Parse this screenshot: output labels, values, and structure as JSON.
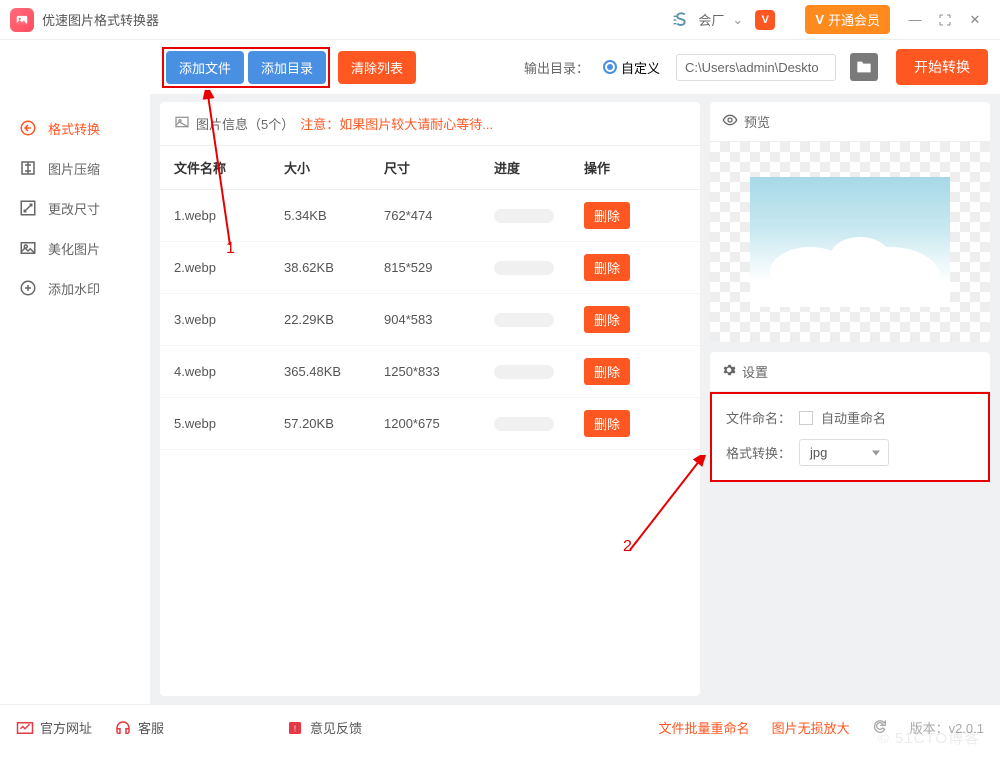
{
  "app": {
    "title": "优速图片格式转换器"
  },
  "titlebar": {
    "user": "会厂",
    "open_vip": "开通会员"
  },
  "toolbar": {
    "add_file": "添加文件",
    "add_folder": "添加目录",
    "clear_list": "清除列表",
    "output_label": "输出目录：",
    "custom_label": "自定义",
    "path": "C:\\Users\\admin\\Deskto",
    "start": "开始转换"
  },
  "sidebar": {
    "items": [
      {
        "label": "格式转换"
      },
      {
        "label": "图片压缩"
      },
      {
        "label": "更改尺寸"
      },
      {
        "label": "美化图片"
      },
      {
        "label": "添加水印"
      }
    ]
  },
  "info": {
    "label": "图片信息（5个）",
    "warn": "注意：如果图片较大请耐心等待..."
  },
  "table": {
    "headers": {
      "name": "文件名称",
      "size": "大小",
      "dim": "尺寸",
      "prog": "进度",
      "act": "操作"
    },
    "delete_label": "删除",
    "rows": [
      {
        "name": "1.webp",
        "size": "5.34KB",
        "dim": "762*474"
      },
      {
        "name": "2.webp",
        "size": "38.62KB",
        "dim": "815*529"
      },
      {
        "name": "3.webp",
        "size": "22.29KB",
        "dim": "904*583"
      },
      {
        "name": "4.webp",
        "size": "365.48KB",
        "dim": "1250*833"
      },
      {
        "name": "5.webp",
        "size": "57.20KB",
        "dim": "1200*675"
      }
    ]
  },
  "preview": {
    "title": "预览"
  },
  "settings": {
    "title": "设置",
    "file_naming_label": "文件命名：",
    "auto_rename": "自动重命名",
    "format_label": "格式转换：",
    "format_value": "jpg"
  },
  "annotations": {
    "one": "1",
    "two": "2"
  },
  "footer": {
    "official": "官方网址",
    "service": "客服",
    "feedback": "意见反馈",
    "batch_rename": "文件批量重命名",
    "lossless_zoom": "图片无损放大",
    "version": "版本：v2.0.1"
  },
  "watermark": "© 51CTO博客"
}
